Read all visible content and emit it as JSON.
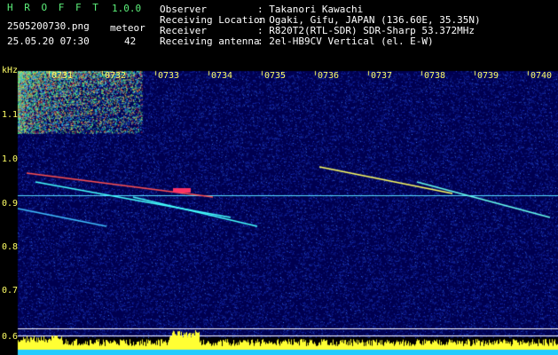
{
  "app": {
    "title": "H R O F F T",
    "version": "1.0.0"
  },
  "file": {
    "name": "2505200730.png",
    "datetime": "25.05.20 07:30"
  },
  "meteor": {
    "label": "meteor",
    "count": "42"
  },
  "info": [
    {
      "key": "Observer",
      "value": ": Takanori Kawachi"
    },
    {
      "key": "Receiving Location",
      "value": ": Ogaki, Gifu, JAPAN (136.60E, 35.35N)"
    },
    {
      "key": "Receiver",
      "value": ": R820T2(RTL-SDR) SDR-Sharp 53.372MHz"
    },
    {
      "key": "Receiving antenna",
      "value": ": 2el-HB9CV Vertical (el. E-W)"
    }
  ],
  "spectrogram": {
    "unit": "kHz",
    "time_ticks": [
      "0731",
      "0732",
      "0733",
      "0734",
      "0735",
      "0736",
      "0737",
      "0738",
      "0739",
      "0740"
    ],
    "freq_ticks": [
      "1.1",
      "1.0",
      "0.9",
      "0.8",
      "0.7",
      "0.6"
    ],
    "colors": {
      "background": "#000050",
      "noise": "#1a3cff",
      "signal": "#ff3333",
      "carrier": "#44ffff"
    }
  }
}
